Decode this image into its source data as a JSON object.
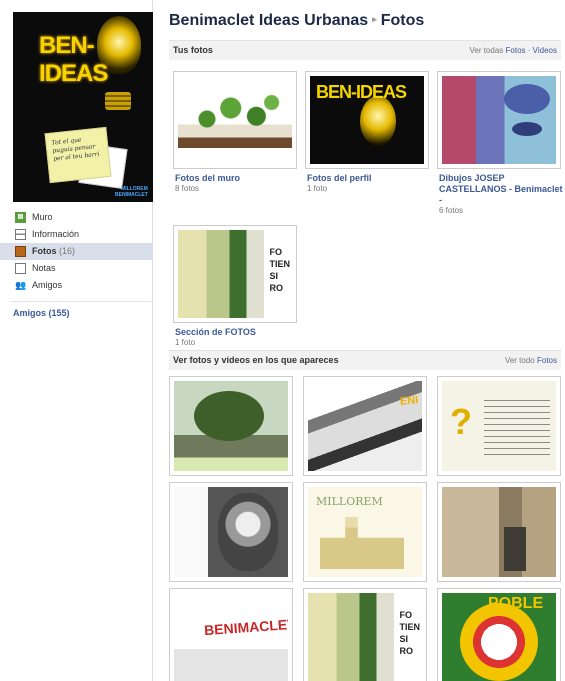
{
  "page": {
    "title": "Benimaclet Ideas Urbanas",
    "title_sep": "▸",
    "subtitle": "Fotos"
  },
  "profile": {
    "pic_title": "BEN-IDEAS",
    "note_text": "Tot el que puguis pensar per al teu barri",
    "brand": "MILLOREM\nBENIMACLET"
  },
  "nav": {
    "items": [
      {
        "label": "Muro",
        "icon": "wall-icon"
      },
      {
        "label": "Información",
        "icon": "info-icon"
      },
      {
        "label": "Fotos",
        "count": "(16)",
        "icon": "photo-icon"
      },
      {
        "label": "Notas",
        "icon": "notes-icon"
      },
      {
        "label": "Amigos",
        "icon": "friends-icon"
      }
    ],
    "friends_link": "Amigos (155)"
  },
  "sections": {
    "your_photos": {
      "title": "Tus fotos",
      "right_prefix": "Ver todas",
      "right_link1": "Fotos",
      "right_dot": "·",
      "right_link2": "Videos"
    },
    "tagged": {
      "title": "Ver fotos y vídeos en los que apareces",
      "right_prefix": "Ver todo",
      "right_link": "Fotos"
    }
  },
  "albums": [
    {
      "name": "Fotos del muro",
      "count": "8 fotos"
    },
    {
      "name": "Fotos del perfil",
      "count": "1 foto"
    },
    {
      "name": "Dibujos JOSEP CASTELLANOS - Benimaclet -",
      "count": "6 fotos"
    },
    {
      "name": "Sección de FOTOS",
      "count": "1 foto"
    }
  ],
  "photo_labels": {
    "bulb_title": "BEN-IDEAS"
  }
}
